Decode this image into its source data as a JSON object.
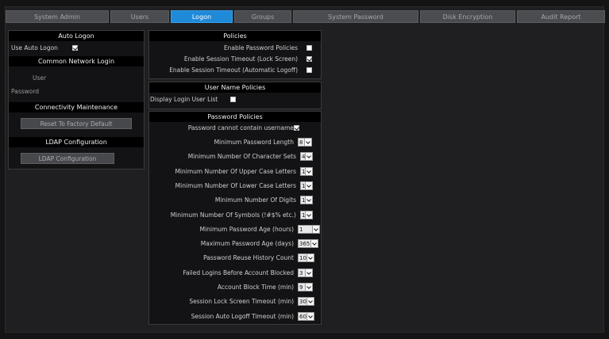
{
  "tabs": [
    {
      "label": "System Admin"
    },
    {
      "label": "Users"
    },
    {
      "label": "Logon"
    },
    {
      "label": "Groups"
    },
    {
      "label": "System Password"
    },
    {
      "label": "Disk Encryption"
    },
    {
      "label": "Audit Report"
    }
  ],
  "active_tab": "Logon",
  "auto_logon": {
    "title": "Auto Logon",
    "use_label": "Use Auto Logon",
    "use_checked": true
  },
  "network_login": {
    "title": "Common Network Login",
    "user_label": "User",
    "password_label": "Password"
  },
  "connectivity": {
    "title": "Connectivity Maintenance",
    "reset_button": "Reset To Factory Default"
  },
  "ldap": {
    "title": "LDAP Configuration",
    "button": "LDAP Configuration"
  },
  "policies": {
    "title": "Policies",
    "items": [
      {
        "label": "Enable Password Policies",
        "checked": false
      },
      {
        "label": "Enable Session Timeout (Lock Screen)",
        "checked": true
      },
      {
        "label": "Enable Session Timeout (Automatic Logoff)",
        "checked": false
      }
    ]
  },
  "user_name_policies": {
    "title": "User Name Policies",
    "display_label": "Display Login User List",
    "display_checked": false
  },
  "password_policies": {
    "title": "Password Policies",
    "no_username_label": "Password cannot contain username",
    "no_username_checked": true,
    "rows": [
      {
        "label": "Minimum Password Length",
        "value": "8"
      },
      {
        "label": "Minimum Number Of Character Sets",
        "value": "4"
      },
      {
        "label": "Minimum Number Of Upper Case Letters",
        "value": "1"
      },
      {
        "label": "Minimum Number Of Lower Case Letters",
        "value": "1"
      },
      {
        "label": "Minimum Number Of Digits",
        "value": "1"
      },
      {
        "label": "Minimum Number Of Symbols (!#$% etc.)",
        "value": "1"
      },
      {
        "label": "Minimum Password Age (hours)",
        "value": "1"
      },
      {
        "label": "Maximum Password Age (days)",
        "value": "365"
      },
      {
        "label": "Password Reuse History Count",
        "value": "10"
      },
      {
        "label": "Failed Logins Before Account Blocked",
        "value": "3"
      },
      {
        "label": "Account Block Time (min)",
        "value": "9"
      },
      {
        "label": "Session Lock Screen Timeout (min)",
        "value": "30"
      },
      {
        "label": "Session Auto Logoff Timeout (min)",
        "value": "60"
      }
    ]
  },
  "colors": {
    "accent": "#1f8ad8",
    "panel_header": "#000000",
    "background": "#1f1f21"
  }
}
